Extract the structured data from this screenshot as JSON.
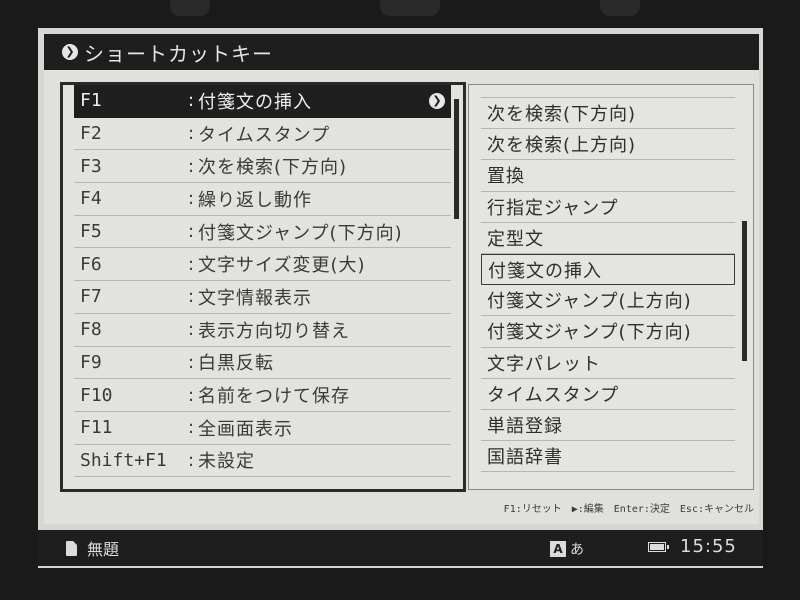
{
  "window": {
    "title": "ショートカットキー",
    "title_icon": "❯"
  },
  "shortcuts": [
    {
      "key": "F1",
      "action": "付箋文の挿入",
      "selected": true
    },
    {
      "key": "F2",
      "action": "タイムスタンプ"
    },
    {
      "key": "F3",
      "action": "次を検索(下方向)"
    },
    {
      "key": "F4",
      "action": "繰り返し動作"
    },
    {
      "key": "F5",
      "action": "付箋文ジャンプ(下方向)"
    },
    {
      "key": "F6",
      "action": "文字サイズ変更(大)"
    },
    {
      "key": "F7",
      "action": "文字情報表示"
    },
    {
      "key": "F8",
      "action": "表示方向切り替え"
    },
    {
      "key": "F9",
      "action": "白黒反転"
    },
    {
      "key": "F10",
      "action": "名前をつけて保存"
    },
    {
      "key": "F11",
      "action": "全画面表示"
    },
    {
      "key": "Shift+F1",
      "action": "未設定"
    }
  ],
  "separator": ":",
  "selected_arrow": "❯",
  "commands": [
    "次を検索(下方向)",
    "次を検索(上方向)",
    "置換",
    "行指定ジャンプ",
    "定型文",
    "付箋文の挿入",
    "付箋文ジャンプ(上方向)",
    "付箋文ジャンプ(下方向)",
    "文字パレット",
    "タイムスタンプ",
    "単語登録",
    "国語辞書"
  ],
  "highlighted_command_index": 5,
  "hints": {
    "reset": "F1:リセット",
    "edit": "▶:編集",
    "enter": "Enter:決定",
    "esc": "Esc:キャンセル"
  },
  "status": {
    "doc_icon": "document-icon",
    "title": "無題",
    "ime_box": "A",
    "ime_mode": "あ",
    "battery_icon": "battery-icon",
    "time": "15:55"
  }
}
